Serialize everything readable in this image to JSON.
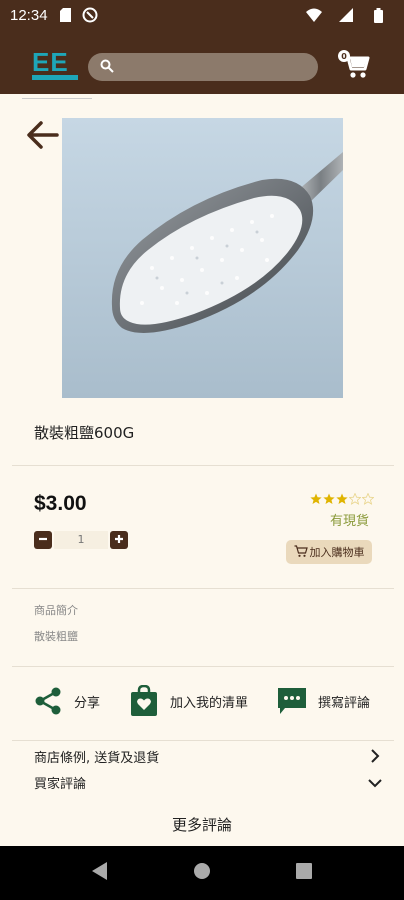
{
  "status_bar": {
    "time": "12:34"
  },
  "header": {
    "logo_text": "EE",
    "search_placeholder": "",
    "cart_count": "0"
  },
  "product": {
    "name": "散裝粗鹽600G",
    "price": "$3.00",
    "rating": 3,
    "rating_max": 5,
    "stock_status": "有現貨",
    "quantity": "1",
    "add_to_cart_label": "加入購物車",
    "intro_label": "商品簡介",
    "intro_text": "散裝粗鹽"
  },
  "actions": {
    "share_label": "分享",
    "wishlist_label": "加入我的清單",
    "write_review_label": "撰寫評論"
  },
  "sections": {
    "policy_label": "商店條例, 送貨及退貨",
    "reviews_label": "買家評論",
    "more_reviews_label": "更多評論"
  },
  "colors": {
    "header_bg": "#4a2d1c",
    "accent_brown": "#4a2d1c",
    "share_green": "#1e5e3a",
    "logo_teal": "#1ea6b8",
    "star_gold": "#e0b400",
    "stock_green": "#8a9a3a"
  },
  "icons": {
    "search": "search-icon",
    "cart": "shopping-cart-icon",
    "back": "arrow-left-icon",
    "share": "share-icon",
    "wishlist": "shopping-bag-heart-icon",
    "review": "comment-icon",
    "chevron_right": "chevron-right-icon",
    "chevron_down": "chevron-down-icon"
  }
}
